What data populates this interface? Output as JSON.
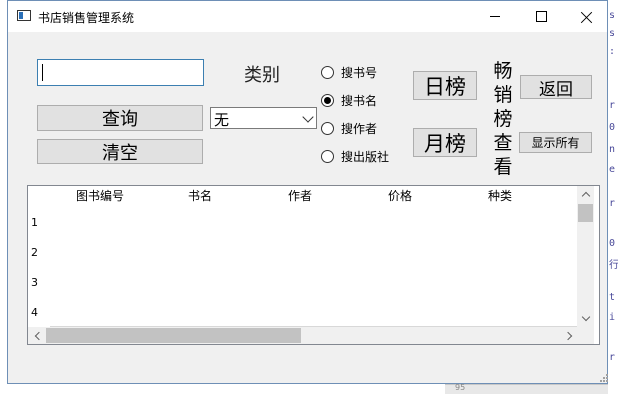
{
  "window": {
    "title": "书店销售管理系统"
  },
  "search": {
    "value": ""
  },
  "buttons": {
    "query": "查询",
    "clear": "清空",
    "day_rank": "日榜",
    "month_rank": "月榜",
    "back": "返回",
    "show_all": "显示所有"
  },
  "category": {
    "label": "类别",
    "selected": "无"
  },
  "search_mode": {
    "options": [
      "搜书号",
      "搜书名",
      "搜作者",
      "搜出版社"
    ],
    "selected": "搜书名"
  },
  "bestseller_label": [
    "畅",
    "销",
    "榜",
    "查",
    "看"
  ],
  "table": {
    "columns": [
      "图书编号",
      "书名",
      "作者",
      "价格",
      "种类"
    ],
    "row_numbers": [
      "1",
      "2",
      "3",
      "4"
    ]
  },
  "colors": {
    "window_bg": "#f0f0f0",
    "focus_border": "#3c7fb1",
    "button_bg": "#e1e1e1"
  }
}
